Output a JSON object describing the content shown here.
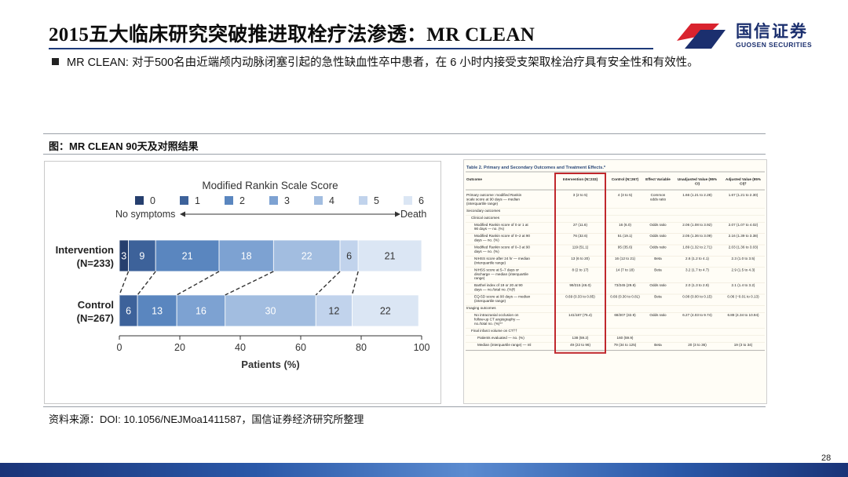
{
  "slide": {
    "title": "2015五大临床研究突破推进取栓疗法渗透：MR CLEAN",
    "bullet": "MR CLEAN: 对于500名由近端颅内动脉闭塞引起的急性缺血性卒中患者，在 6 小时内接受支架取栓治疗具有安全性和有效性。",
    "figure_caption": "图：MR CLEAN 90天及对照结果",
    "source": "资料来源：DOI: 10.1056/NEJMoa1411587，国信证券经济研究所整理",
    "page_number": "28"
  },
  "logo": {
    "name_cn": "国信证券",
    "name_en": "GUOSEN SECURITIES",
    "colors": {
      "red": "#d9232e",
      "blue": "#1b2f6e"
    }
  },
  "chart_data": [
    {
      "type": "bar",
      "orientation": "horizontal-stacked",
      "title": "Modified Rankin Scale Score",
      "legend": {
        "labels": [
          "0",
          "1",
          "2",
          "3",
          "4",
          "5",
          "6"
        ],
        "colors": [
          "#263f6e",
          "#3d629a",
          "#5a86bf",
          "#7da2d2",
          "#a2bde0",
          "#c1d3ec",
          "#dbe6f4"
        ],
        "left_caption": "No symptoms",
        "right_caption": "Death"
      },
      "categories": [
        {
          "name": "Intervention",
          "n": "(N=233)"
        },
        {
          "name": "Control",
          "n": "(N=267)"
        }
      ],
      "series": [
        {
          "name": "0",
          "values": [
            3,
            0
          ]
        },
        {
          "name": "1",
          "values": [
            9,
            6
          ]
        },
        {
          "name": "2",
          "values": [
            21,
            13
          ]
        },
        {
          "name": "3",
          "values": [
            18,
            16
          ]
        },
        {
          "name": "4",
          "values": [
            22,
            30
          ]
        },
        {
          "name": "5",
          "values": [
            6,
            12
          ]
        },
        {
          "name": "6",
          "values": [
            21,
            22
          ]
        }
      ],
      "bar_labels": [
        [
          "3",
          "9",
          "21",
          "18",
          "22",
          "6",
          "21"
        ],
        [
          "",
          "6",
          "13",
          "16",
          "30",
          "12",
          "22"
        ]
      ],
      "xlabel": "Patients (%)",
      "ylabel": "",
      "xlim": [
        0,
        100
      ],
      "xticks": [
        "0",
        "20",
        "40",
        "60",
        "80",
        "100"
      ]
    },
    {
      "type": "table",
      "title": "Table 2. Primary and Secondary Outcomes and Treatment Effects.*",
      "columns": [
        "Outcome",
        "Intervention (N=233)",
        "Control (N=267)",
        "Effect Variable",
        "Unadjusted Value (95% CI)",
        "Adjusted Value (95% CI)†"
      ],
      "rows": [
        [
          "Primary outcome: modified Rankin scale score at 90 days — median (interquartile range)",
          "3 (2 to 5)",
          "4 (3 to 5)",
          "Common odds ratio",
          "1.66 (1.21 to 2.28)",
          "1.67 (1.21 to 2.30)"
        ],
        [
          "Secondary outcomes",
          "",
          "",
          "",
          "",
          ""
        ],
        [
          "Clinical outcomes",
          "",
          "",
          "",
          "",
          ""
        ],
        [
          "Modified Rankin score of 0 or 1 at 90 days — no. (%)",
          "27 (11.6)",
          "16 (6.0)",
          "Odds ratio",
          "2.06 (1.08 to 3.92)",
          "2.07 (1.07 to 4.02)"
        ],
        [
          "Modified Rankin score of 0–2 at 90 days — no. (%)",
          "76 (32.6)",
          "51 (19.1)",
          "Odds ratio",
          "2.05 (1.36 to 3.09)",
          "2.16 (1.39 to 3.38)"
        ],
        [
          "Modified Rankin score of 0–3 at 90 days — no. (%)",
          "119 (51.1)",
          "95 (35.6)",
          "Odds ratio",
          "1.89 (1.32 to 2.71)",
          "2.03 (1.36 to 3.03)"
        ],
        [
          "NIHSS score after 24 hr — median (interquartile range)",
          "13 (6 to 20)",
          "16 (12 to 21)",
          "Beta",
          "2.6 (1.2 to 4.1)",
          "2.3 (1.0 to 3.5)"
        ],
        [
          "NIHSS score at 5–7 days or discharge — median (interquartile range)",
          "8 (2 to 17)",
          "14 (7 to 18)",
          "Beta",
          "3.2 (1.7 to 4.7)",
          "2.9 (1.5 to 4.3)"
        ],
        [
          "Barthel index of 19 or 20 at 90 days — no./total no. (%)¶",
          "99/215 (46.0)",
          "73/245 (29.8)",
          "Odds ratio",
          "2.0 (1.3 to 2.9)",
          "2.1 (1.4 to 3.2)"
        ],
        [
          "EQ-5D score at 90 days — median (interquartile range)",
          "0.69 (0.33 to 0.85)",
          "0.66 (0.30 to 0.81)",
          "Beta",
          "0.08 (0.00 to 0.15)",
          "0.06 (−0.01 to 0.13)"
        ],
        [
          "Imaging outcomes",
          "",
          "",
          "",
          "",
          ""
        ],
        [
          "No intracranial occlusion on follow-up CT angiography — no./total no. (%)**",
          "141/187 (75.4)",
          "68/207 (32.9)",
          "Odds ratio",
          "6.27 (4.03 to 9.74)",
          "6.88 (4.34 to 10.94)"
        ],
        [
          "Final infarct volume on CT††",
          "",
          "",
          "",
          "",
          ""
        ],
        [
          "Patients evaluated — no. (%)",
          "138 (59.2)",
          "160 (59.9)",
          "",
          "",
          ""
        ],
        [
          "Median (interquartile range) — ml",
          "49 (22 to 96)",
          "79 (34 to 125)",
          "Beta",
          "20 (3 to 36)",
          "19 (3 to 34)"
        ]
      ],
      "highlight_color": "#c0282d"
    }
  ]
}
